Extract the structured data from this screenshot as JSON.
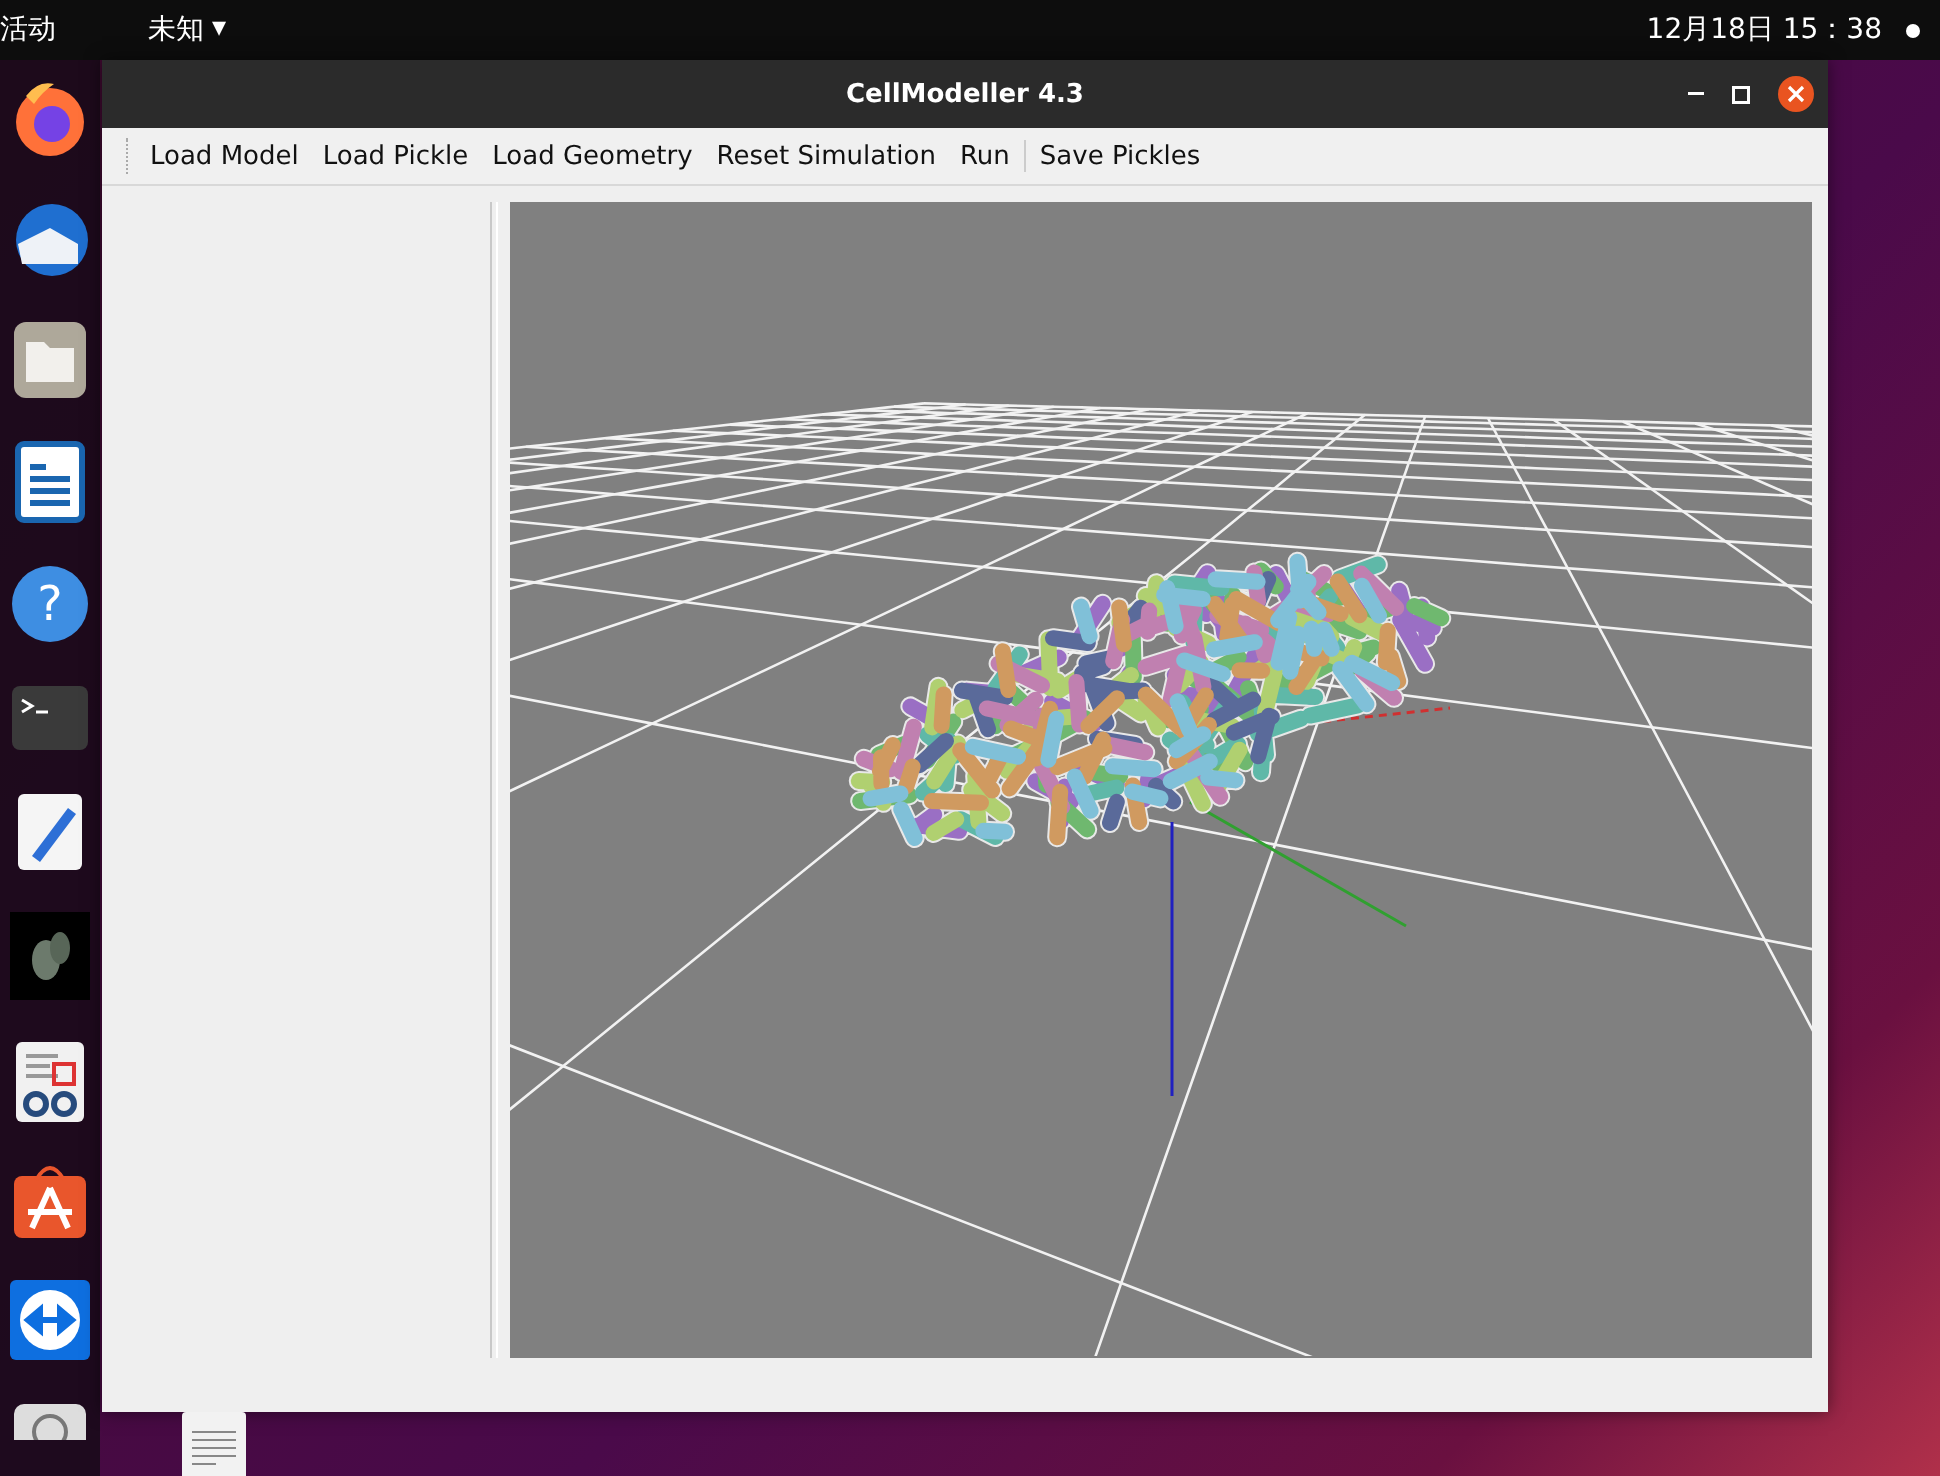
{
  "top_bar": {
    "activities": "活动",
    "app_menu": "未知",
    "app_menu_caret": "▾",
    "clock": "12月18日  15：38"
  },
  "dock": {
    "help_glyph": "?"
  },
  "window": {
    "title": "CellModeller 4.3"
  },
  "toolbar": {
    "buttons": [
      "Load Model",
      "Load Pickle",
      "Load Geometry",
      "Reset Simulation",
      "Run",
      "Save Pickles"
    ]
  }
}
